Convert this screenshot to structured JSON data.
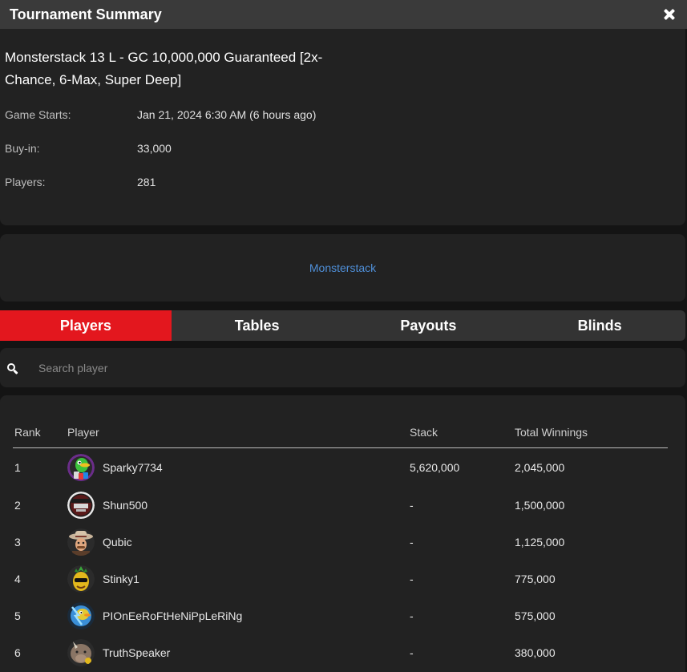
{
  "window": {
    "title": "Tournament Summary"
  },
  "tournament": {
    "name": "Monsterstack 13 L - GC 10,000,000 Guaranteed [2x-Chance, 6-Max, Super Deep]",
    "fields": [
      {
        "label": "Game Starts:",
        "value": "Jan 21, 2024 6:30 AM (6 hours ago)"
      },
      {
        "label": "Buy-in:",
        "value": "33,000"
      },
      {
        "label": "Players:",
        "value": "281"
      }
    ],
    "series_link": "Monsterstack"
  },
  "tabs": [
    {
      "label": "Players",
      "active": true
    },
    {
      "label": "Tables",
      "active": false
    },
    {
      "label": "Payouts",
      "active": false
    },
    {
      "label": "Blinds",
      "active": false
    }
  ],
  "search": {
    "placeholder": "Search player"
  },
  "table": {
    "headers": {
      "rank": "Rank",
      "player": "Player",
      "stack": "Stack",
      "winnings": "Total Winnings"
    },
    "rows": [
      {
        "rank": "1",
        "player": "Sparky7734",
        "stack": "5,620,000",
        "winnings": "2,045,000",
        "avatar": "green-duck-avatar-icon"
      },
      {
        "rank": "2",
        "player": "Shun500",
        "stack": "-",
        "winnings": "1,500,000",
        "avatar": "us-poker-open-avatar-icon"
      },
      {
        "rank": "3",
        "player": "Qubic",
        "stack": "-",
        "winnings": "1,125,000",
        "avatar": "cowboy-avatar-icon"
      },
      {
        "rank": "4",
        "player": "Stinky1",
        "stack": "-",
        "winnings": "775,000",
        "avatar": "pineapple-avatar-icon"
      },
      {
        "rank": "5",
        "player": "PIOnEeRoFtHeNiPpLeRiNg",
        "stack": "-",
        "winnings": "575,000",
        "avatar": "lightning-duck-avatar-icon"
      },
      {
        "rank": "6",
        "player": "TruthSpeaker",
        "stack": "-",
        "winnings": "380,000",
        "avatar": "rhino-avatar-icon"
      }
    ]
  },
  "colors": {
    "accent": "#e3171e",
    "link": "#4f8fd8",
    "panel": "#222222",
    "background": "#141414"
  }
}
